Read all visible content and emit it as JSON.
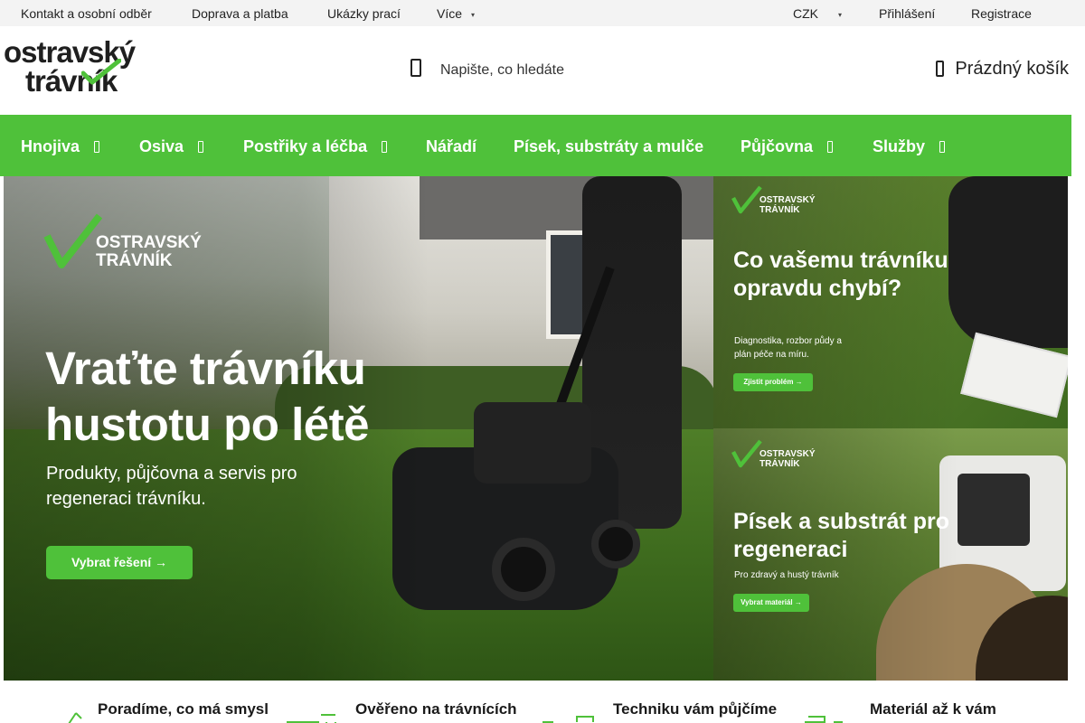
{
  "topbar": {
    "contact": "Kontakt a osobní odběr",
    "shipping": "Doprava a platba",
    "gallery": "Ukázky prací",
    "more": "Více",
    "currency": "CZK",
    "login": "Přihlášení",
    "register": "Registrace"
  },
  "header": {
    "logo_line1": "ostravský",
    "logo_line2": "trávník",
    "search_placeholder": "Napište, co hledáte",
    "cart_label": "Prázdný košík"
  },
  "nav": {
    "items": [
      {
        "label": "Hnojiva",
        "has_dropdown": true
      },
      {
        "label": "Osiva",
        "has_dropdown": true
      },
      {
        "label": "Postřiky a léčba",
        "has_dropdown": true
      },
      {
        "label": "Nářadí",
        "has_dropdown": false
      },
      {
        "label": "Písek, substráty a mulče",
        "has_dropdown": false
      },
      {
        "label": "Půjčovna",
        "has_dropdown": true
      },
      {
        "label": "Služby",
        "has_dropdown": true
      }
    ]
  },
  "hero": {
    "brand_line1": "OSTRAVSKÝ",
    "brand_line2": "TRÁVNÍK",
    "title": "Vraťte trávníku hustotu po létě",
    "subtitle": "Produkty, půjčovna a servis pro regeneraci trávníku.",
    "button": "Vybrat řešení →"
  },
  "side_banners": [
    {
      "brand_line1": "OSTRAVSKÝ",
      "brand_line2": "TRÁVNÍK",
      "title": "Co vašemu trávníku opravdu chybí?",
      "subtitle": "Diagnostika, rozbor půdy a plán péče na míru.",
      "button": "Zjistit problém →"
    },
    {
      "brand_line1": "OSTRAVSKÝ",
      "brand_line2": "TRÁVNÍK",
      "title": "Písek a substrát pro regeneraci",
      "subtitle": "Pro zdravý a hustý trávník",
      "button": "Vybrat materiál →"
    }
  ],
  "benefits": [
    {
      "title": "Poradíme, co má smysl",
      "icon": "advice-icon"
    },
    {
      "title": "Ověřeno na trávnících",
      "icon": "lawn-roller-icon"
    },
    {
      "title": "Techniku vám půjčíme",
      "icon": "rental-machine-icon"
    },
    {
      "title": "Materiál až k vám",
      "icon": "delivery-truck-icon"
    }
  ],
  "colors": {
    "brand_green": "#4fc13a",
    "topbar_bg": "#f3f3f3",
    "text_dark": "#1a1a1a"
  }
}
